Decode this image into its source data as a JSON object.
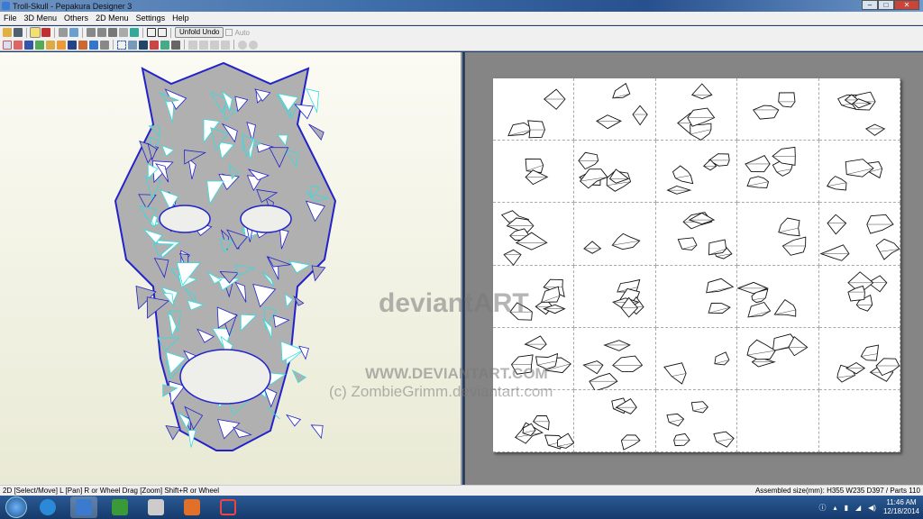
{
  "window": {
    "title": "Troll-Skull - Pepakura Designer 3"
  },
  "menu": [
    "File",
    "3D Menu",
    "Others",
    "2D Menu",
    "Settings",
    "Help"
  ],
  "toolbar": {
    "unfold_undo": "Unfold Undo",
    "auto_label": "Auto"
  },
  "status": {
    "left": "2D [Select/Move] L [Pan] R or Wheel Drag [Zoom] Shift+R or Wheel",
    "right": "Assembled size(mm): H355 W235 D397 / Parts 110"
  },
  "watermark": {
    "logo": "deviantART",
    "site": "WWW.DEVIANTART.COM",
    "credit": "(c) ZombieGrimm.deviantart.com"
  },
  "taskbar": {
    "time": "11:46 AM",
    "date": "12/18/2014",
    "apps": [
      "internet-explorer",
      "pepakura",
      "app-green",
      "app-media",
      "app-office",
      "app-red"
    ]
  },
  "colors": {
    "edges": "#2222cc",
    "fold": "#33dddd",
    "face": "#ffffff",
    "shade": "#b0b0b0"
  }
}
